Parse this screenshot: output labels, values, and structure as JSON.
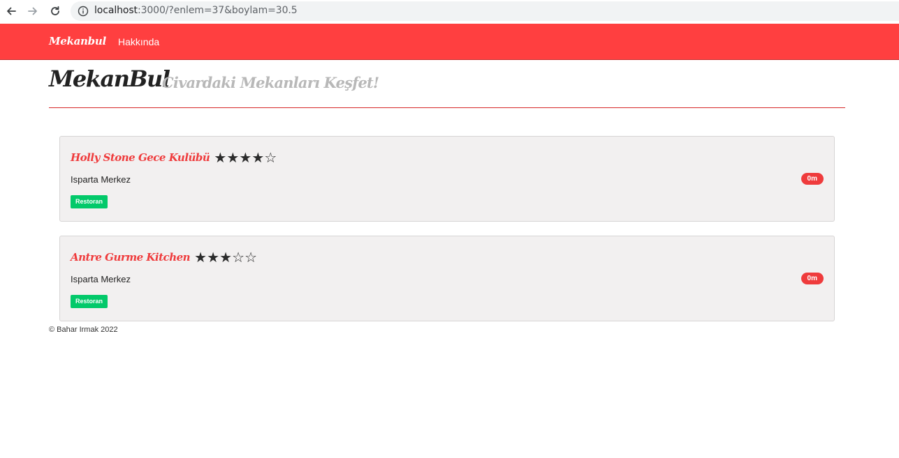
{
  "browser": {
    "url_host": "localhost",
    "url_rest": ":3000/?enlem=37&boylam=30.5"
  },
  "navbar": {
    "brand": "Mekanbul",
    "link_about": "Hakkında"
  },
  "header": {
    "title": "MekanBul",
    "subtitle": "Civardaki Mekanları Keşfet!"
  },
  "places": [
    {
      "name": "Holly Stone Gece Kulübü",
      "rating": 4,
      "stars": [
        "★",
        "★",
        "★",
        "★",
        "☆"
      ],
      "address": "Isparta Merkez",
      "facility": "Restoran",
      "distance": "0m"
    },
    {
      "name": "Antre Gurme Kitchen",
      "rating": 3,
      "stars": [
        "★",
        "★",
        "★",
        "☆",
        "☆"
      ],
      "address": "Isparta Merkez",
      "facility": "Restoran",
      "distance": "0m"
    }
  ],
  "footer": {
    "text": "© Bahar Irmak 2022"
  },
  "colors": {
    "brand_red": "#ff3f40",
    "title_red": "#ef3b3c",
    "badge_green": "#02c96a",
    "card_bg": "#f2f0f0"
  }
}
